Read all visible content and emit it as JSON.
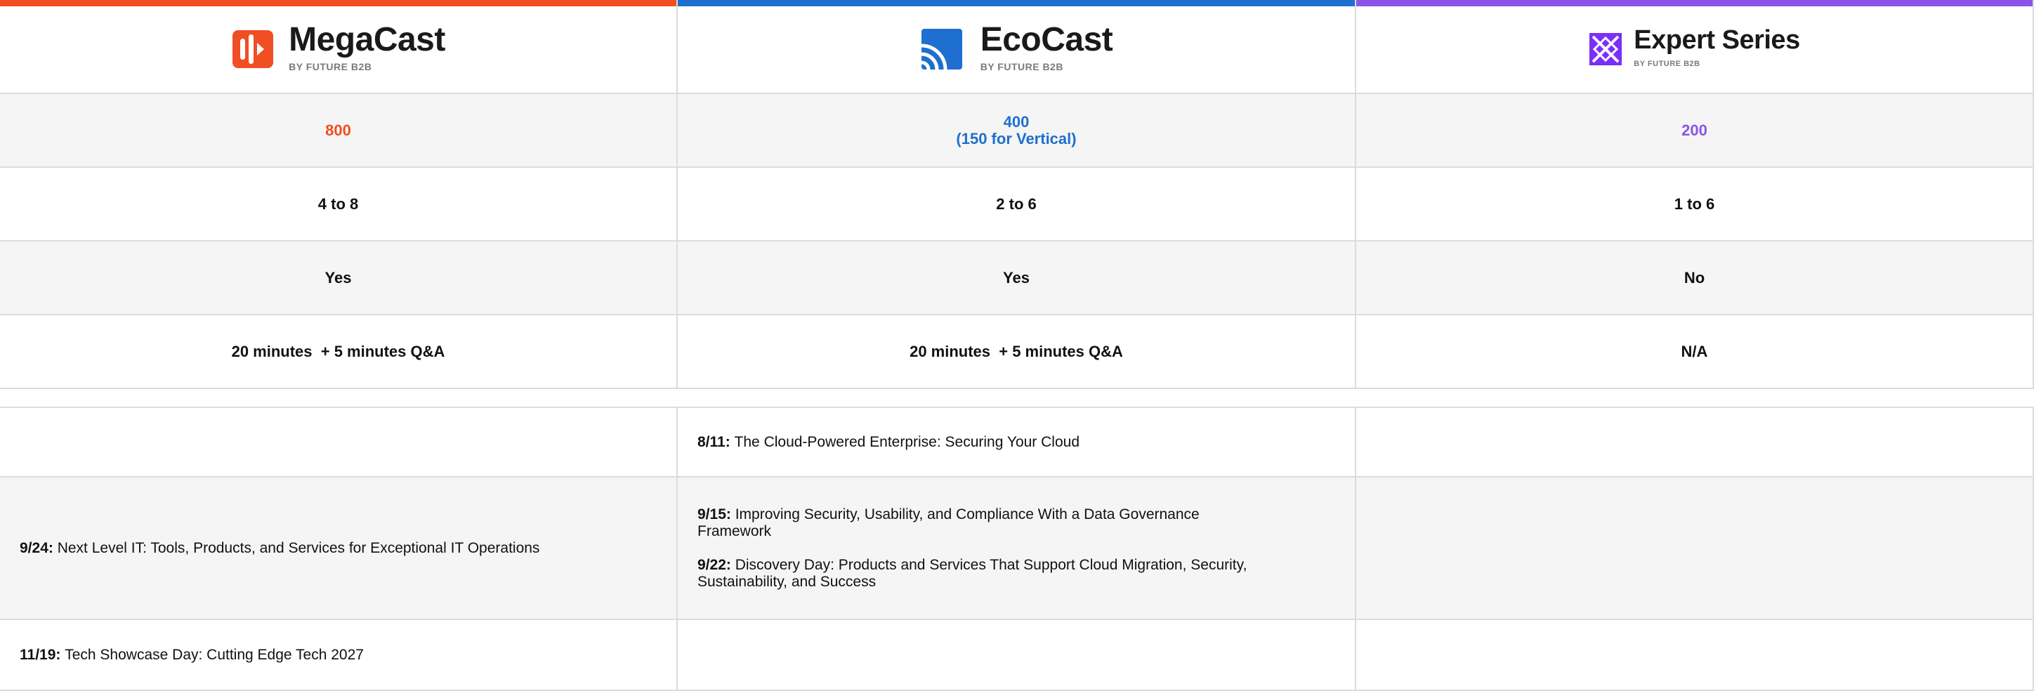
{
  "colors": {
    "megacast": "#f04e23",
    "ecocast": "#1e6fcf",
    "expert": "#8a55e6",
    "border": "#dcdcdc",
    "alt_row": "#f5f5f5"
  },
  "brands": [
    {
      "name": "MegaCast",
      "sub": "BY FUTURE B2B",
      "icon": "megacast-logo-icon"
    },
    {
      "name": "EcoCast",
      "sub": "BY FUTURE B2B",
      "icon": "ecocast-logo-icon"
    },
    {
      "name": "Expert Series",
      "sub": "BY FUTURE B2B",
      "icon": "expert-series-logo-icon"
    }
  ],
  "rows": [
    {
      "values": [
        "800",
        "400\n(150 for Vertical)",
        "200"
      ]
    },
    {
      "values": [
        "4 to 8",
        "2 to 6",
        "1 to 6"
      ]
    },
    {
      "values": [
        "Yes",
        "Yes",
        "No"
      ]
    },
    {
      "values": [
        "20 minutes  + 5 minutes Q&A",
        "20 minutes  + 5 minutes Q&A",
        "N/A"
      ]
    }
  ],
  "schedule": {
    "ecocast_1": {
      "date": "8/11:",
      "title": "The Cloud-Powered Enterprise: Securing Your Cloud"
    },
    "megacast_1": {
      "date": "9/24:",
      "title": "Next Level IT: Tools, Products, and Services for Exceptional IT Operations"
    },
    "ecocast_2": {
      "date": "9/15:",
      "title": "Improving Security, Usability, and Compliance With a Data Governance Framework"
    },
    "ecocast_3": {
      "date": "9/22:",
      "title": "Discovery Day: Products and Services That Support Cloud Migration, Security, Sustainability, and Success"
    },
    "megacast_2": {
      "date": "11/19:",
      "title": "Tech Showcase Day: Cutting Edge Tech 2027"
    }
  }
}
